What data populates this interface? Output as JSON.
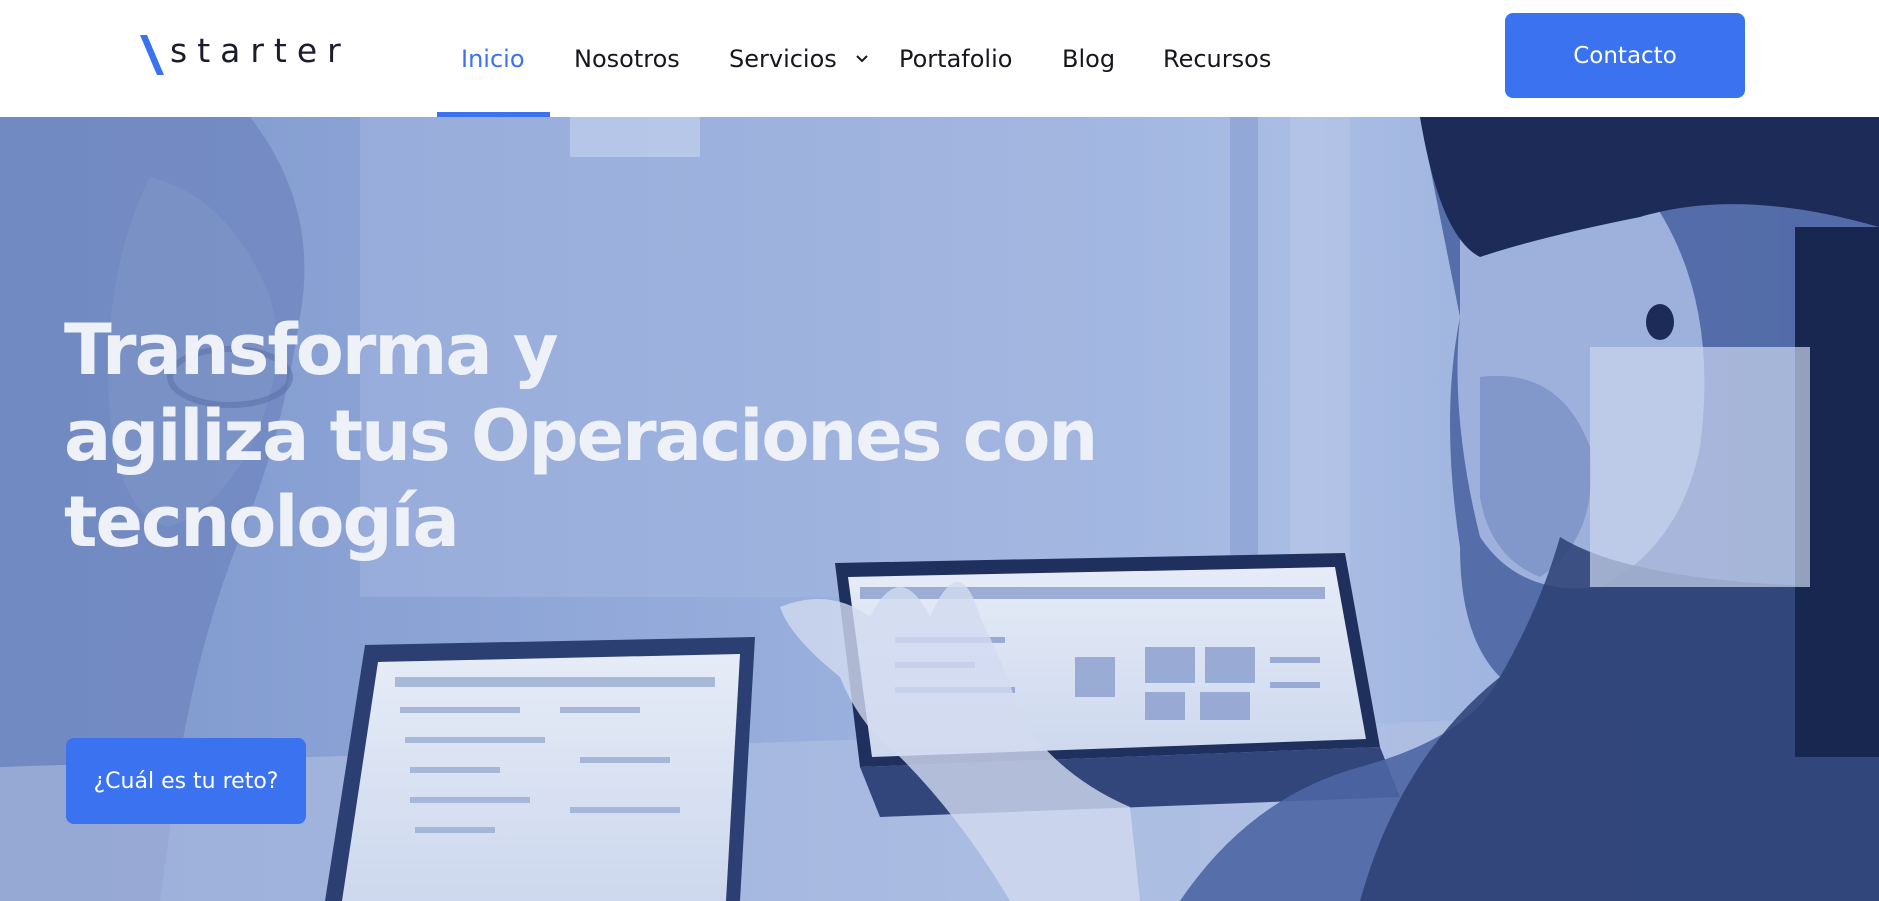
{
  "brand": {
    "name": "starter",
    "accent_color": "#3b72f0",
    "text_color": "#16161f"
  },
  "nav": {
    "items": [
      {
        "label": "Inicio",
        "active": true
      },
      {
        "label": "Nosotros",
        "active": false
      },
      {
        "label": "Servicios",
        "active": false,
        "icon": "chevron-down-icon"
      },
      {
        "label": "Portafolio",
        "active": false
      },
      {
        "label": "Blog",
        "active": false
      },
      {
        "label": "Recursos",
        "active": false
      }
    ],
    "cta_label": "Contacto"
  },
  "hero": {
    "title_lines": [
      "Transforma y",
      "agiliza tus Operaciones con",
      "tecnología"
    ],
    "cta_label": "¿Cuál es tu reto?",
    "overlay_color": "#8ea5d6",
    "background_description_icon": "office-photo"
  }
}
